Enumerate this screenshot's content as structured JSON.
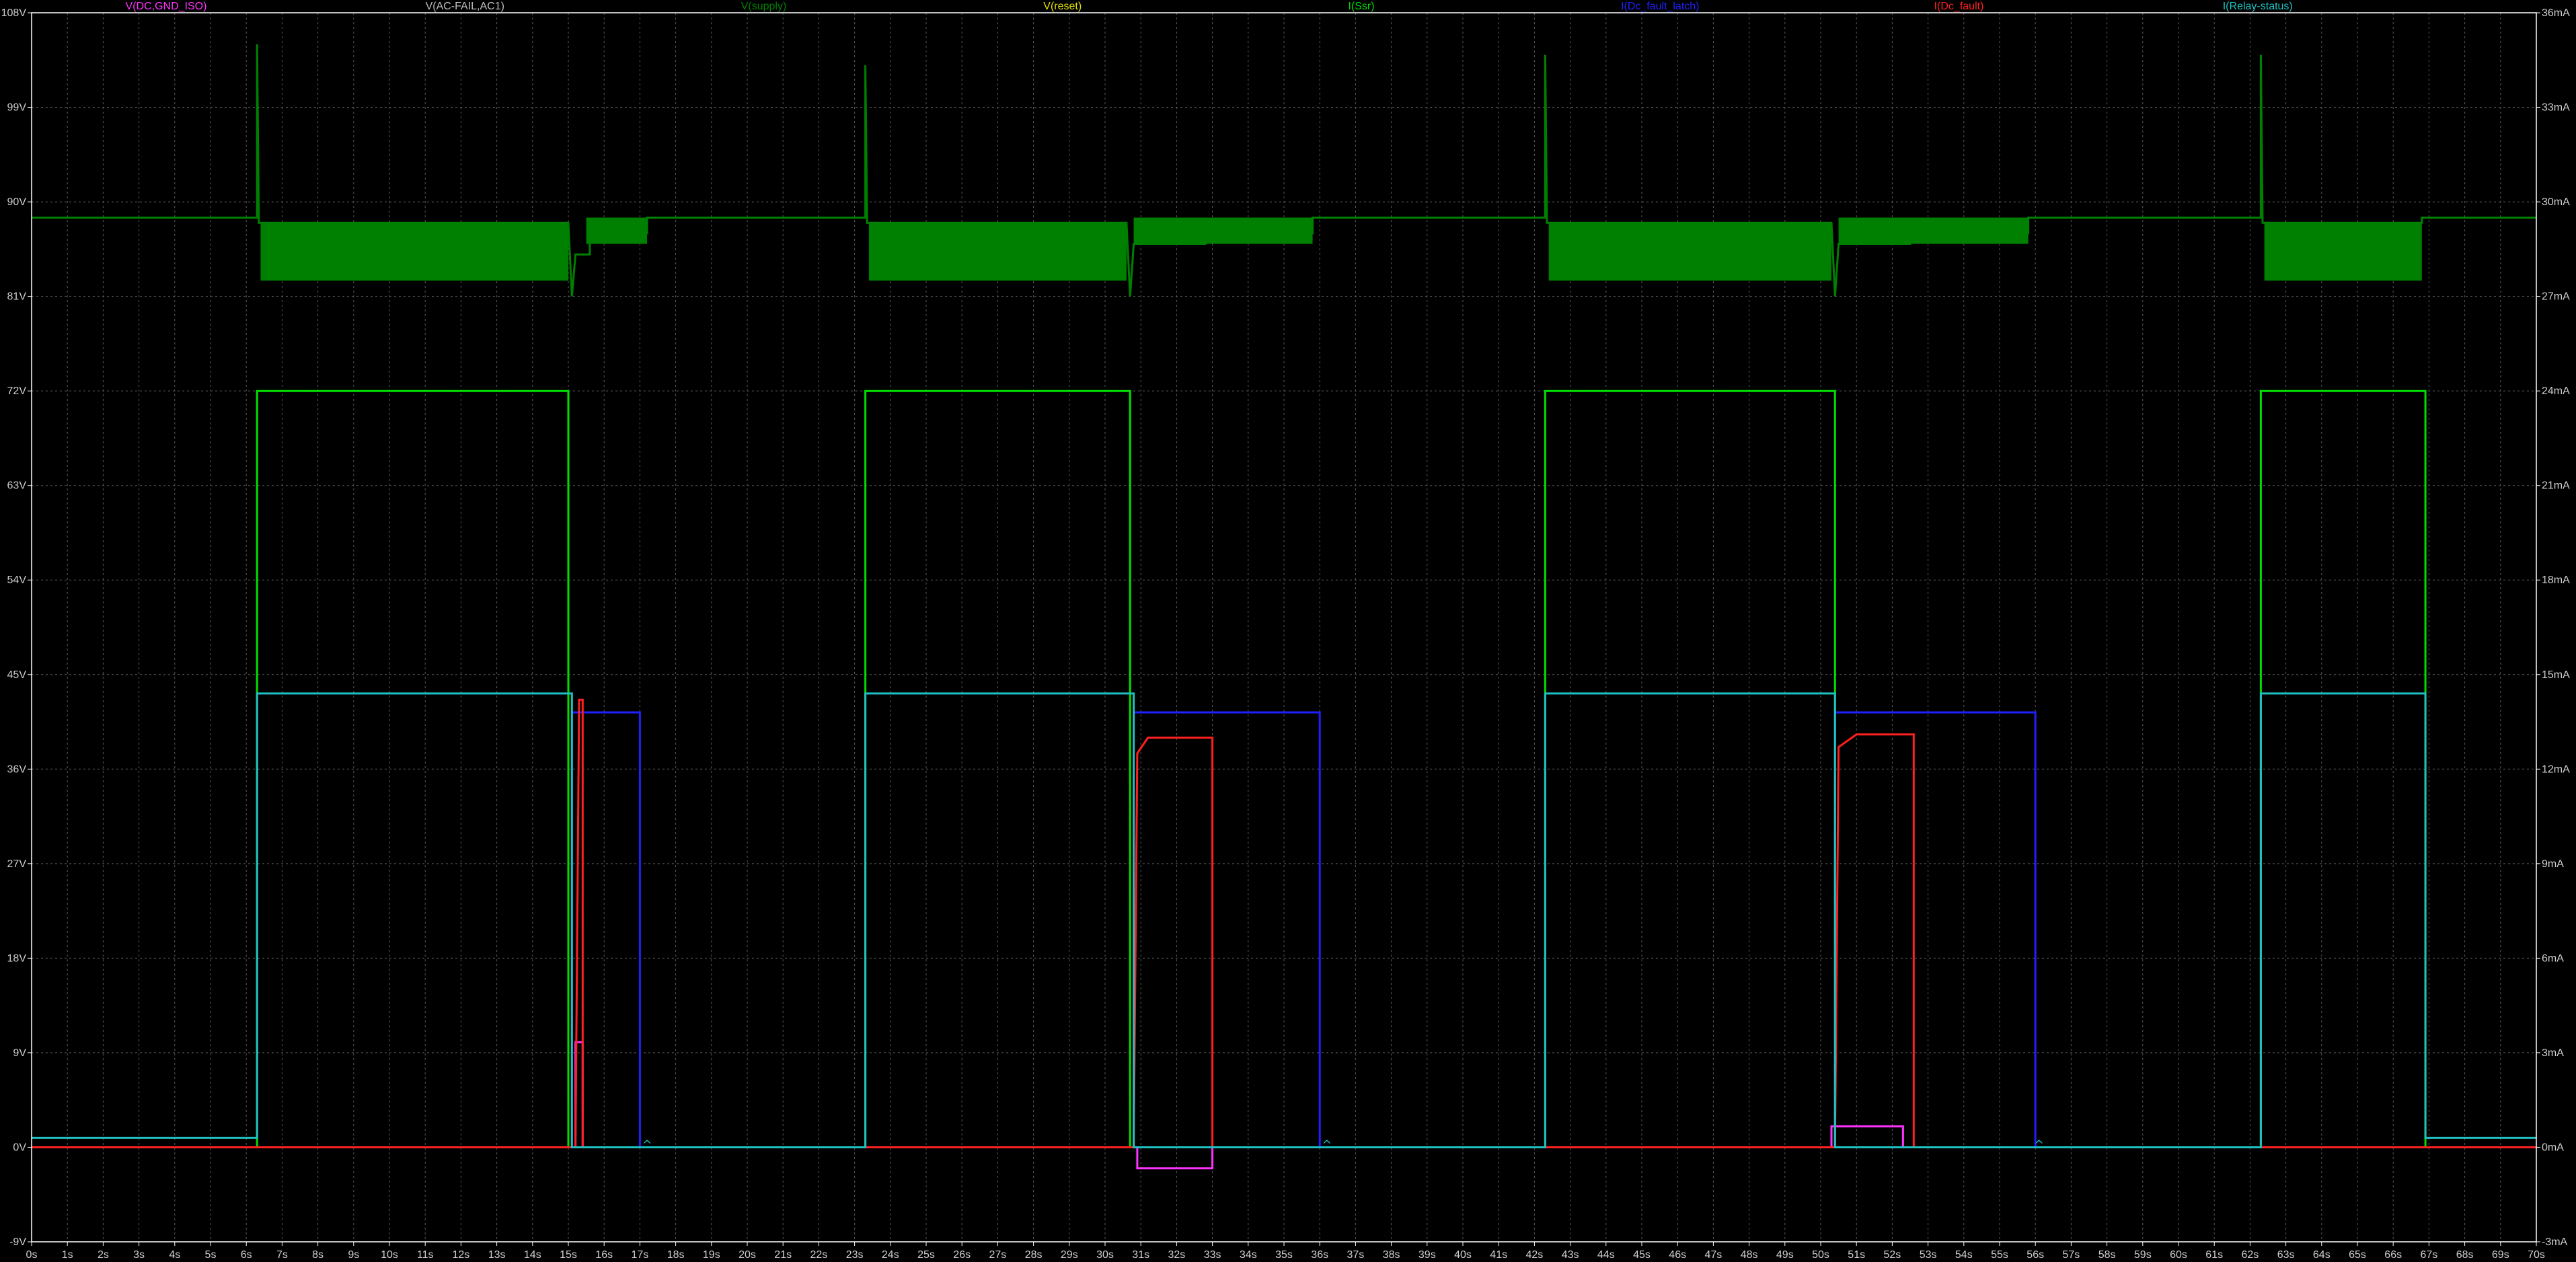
{
  "chart_data": {
    "type": "line",
    "title": "",
    "xlabel": "",
    "ylabel": "",
    "xlim": [
      0,
      70
    ],
    "ylim_left": [
      -9,
      108
    ],
    "ylim_right": [
      -3,
      36
    ],
    "x_unit": "s",
    "left_unit": "V",
    "right_unit": "mA",
    "x_ticks": [
      "0s",
      "1s",
      "2s",
      "3s",
      "4s",
      "5s",
      "6s",
      "7s",
      "8s",
      "9s",
      "10s",
      "11s",
      "12s",
      "13s",
      "14s",
      "15s",
      "16s",
      "17s",
      "18s",
      "19s",
      "20s",
      "21s",
      "22s",
      "23s",
      "24s",
      "25s",
      "26s",
      "27s",
      "28s",
      "29s",
      "30s",
      "31s",
      "32s",
      "33s",
      "34s",
      "35s",
      "36s",
      "37s",
      "38s",
      "39s",
      "40s",
      "41s",
      "42s",
      "43s",
      "44s",
      "45s",
      "46s",
      "47s",
      "48s",
      "49s",
      "50s",
      "51s",
      "52s",
      "53s",
      "54s",
      "55s",
      "56s",
      "57s",
      "58s",
      "59s",
      "60s",
      "61s",
      "62s",
      "63s",
      "64s",
      "65s",
      "66s",
      "67s",
      "68s",
      "69s",
      "70s"
    ],
    "left_ticks": [
      "108V",
      "99V",
      "90V",
      "81V",
      "72V",
      "63V",
      "54V",
      "45V",
      "36V",
      "27V",
      "18V",
      "9V",
      "0V",
      "-9V"
    ],
    "right_ticks": [
      "36mA",
      "33mA",
      "30mA",
      "27mA",
      "24mA",
      "21mA",
      "18mA",
      "15mA",
      "12mA",
      "9mA",
      "6mA",
      "3mA",
      "0mA",
      "-3mA"
    ],
    "grid": true,
    "legend_position": "top",
    "colors": {
      "background": "#000000",
      "grid": "#5a5a5a",
      "axis": "#ffffff"
    },
    "series": [
      {
        "name": "V(DC,GND_ISO)",
        "color": "#ff33ff",
        "axis": "left",
        "points": [
          [
            0,
            0
          ],
          [
            15.2,
            0
          ],
          [
            15.2,
            10
          ],
          [
            15.4,
            10
          ],
          [
            15.4,
            0
          ],
          [
            30.9,
            0
          ],
          [
            30.9,
            -2
          ],
          [
            33.0,
            -2
          ],
          [
            33.0,
            0
          ],
          [
            50.3,
            0
          ],
          [
            50.3,
            2
          ],
          [
            52.3,
            2
          ],
          [
            52.3,
            0
          ],
          [
            70,
            0
          ]
        ]
      },
      {
        "name": "V(AC-FAIL,AC1)",
        "color": "#c0c0c0",
        "axis": "left",
        "points": [
          [
            0,
            0
          ],
          [
            70,
            0
          ]
        ]
      },
      {
        "name": "V(supply)",
        "color": "#008000",
        "axis": "left",
        "points": [
          [
            0,
            88.5
          ],
          [
            6.3,
            88.5
          ],
          [
            6.3,
            105
          ],
          [
            6.35,
            88
          ],
          [
            6.4,
            88
          ],
          [
            15.0,
            88
          ],
          [
            15.1,
            81
          ],
          [
            15.2,
            85
          ],
          [
            15.6,
            85
          ],
          [
            15.6,
            87
          ],
          [
            17.2,
            87
          ],
          [
            17.2,
            88.5
          ],
          [
            23.3,
            88.5
          ],
          [
            23.3,
            103
          ],
          [
            23.35,
            88
          ],
          [
            23.4,
            88
          ],
          [
            30.6,
            88
          ],
          [
            30.7,
            81
          ],
          [
            30.8,
            86
          ],
          [
            32.8,
            86
          ],
          [
            32.8,
            87
          ],
          [
            35.8,
            87
          ],
          [
            35.8,
            88.5
          ],
          [
            42.3,
            88.5
          ],
          [
            42.3,
            104
          ],
          [
            42.35,
            88
          ],
          [
            42.4,
            88
          ],
          [
            50.3,
            88
          ],
          [
            50.4,
            81
          ],
          [
            50.5,
            86
          ],
          [
            52.5,
            86
          ],
          [
            52.5,
            87
          ],
          [
            55.8,
            87
          ],
          [
            55.8,
            88.5
          ],
          [
            62.3,
            88.5
          ],
          [
            62.3,
            104
          ],
          [
            62.35,
            88
          ],
          [
            62.4,
            88
          ],
          [
            66.8,
            88
          ],
          [
            66.8,
            88.5
          ],
          [
            70,
            88.5
          ]
        ],
        "band": [
          [
            6.4,
            15.0,
            82.5,
            88
          ],
          [
            23.4,
            30.6,
            82.5,
            88
          ],
          [
            42.4,
            50.3,
            82.5,
            88
          ],
          [
            62.4,
            66.8,
            82.5,
            88
          ],
          [
            15.5,
            17.2,
            86,
            88.5
          ],
          [
            30.8,
            35.8,
            86,
            88.5
          ],
          [
            50.5,
            55.8,
            86,
            88.5
          ]
        ]
      },
      {
        "name": "V(reset)",
        "color": "#e0e000",
        "axis": "left",
        "points": [
          [
            0,
            0
          ],
          [
            70,
            0
          ]
        ]
      },
      {
        "name": "I(Ssr)",
        "color": "#00dd00",
        "axis": "right",
        "points": [
          [
            0,
            0
          ],
          [
            6.3,
            0
          ],
          [
            6.3,
            24
          ],
          [
            15.0,
            24
          ],
          [
            15.0,
            0
          ],
          [
            23.3,
            0
          ],
          [
            23.3,
            24
          ],
          [
            30.7,
            24
          ],
          [
            30.7,
            0
          ],
          [
            42.3,
            0
          ],
          [
            42.3,
            24
          ],
          [
            50.4,
            24
          ],
          [
            50.4,
            0
          ],
          [
            62.3,
            0
          ],
          [
            62.3,
            24
          ],
          [
            66.9,
            24
          ],
          [
            66.9,
            0
          ],
          [
            70,
            0
          ]
        ]
      },
      {
        "name": "I(Dc_fault_latch)",
        "color": "#2020ff",
        "axis": "right",
        "points": [
          [
            0,
            0
          ],
          [
            15.1,
            0
          ],
          [
            15.1,
            13.8
          ],
          [
            17.0,
            13.8
          ],
          [
            17.0,
            0
          ],
          [
            30.8,
            0
          ],
          [
            30.8,
            13.8
          ],
          [
            36.0,
            13.8
          ],
          [
            36.0,
            0
          ],
          [
            50.4,
            0
          ],
          [
            50.4,
            13.8
          ],
          [
            56.0,
            13.8
          ],
          [
            56.0,
            0
          ],
          [
            70,
            0
          ]
        ]
      },
      {
        "name": "I(Dc_fault)",
        "color": "#ff2020",
        "axis": "right",
        "points": [
          [
            0,
            0
          ],
          [
            15.2,
            0
          ],
          [
            15.3,
            14.2
          ],
          [
            15.4,
            14.2
          ],
          [
            15.4,
            0
          ],
          [
            30.8,
            0
          ],
          [
            30.9,
            12.5
          ],
          [
            31.2,
            13
          ],
          [
            33.0,
            13
          ],
          [
            33.0,
            0
          ],
          [
            50.4,
            0
          ],
          [
            50.5,
            12.7
          ],
          [
            51.0,
            13.1
          ],
          [
            52.6,
            13.1
          ],
          [
            52.6,
            0
          ],
          [
            70,
            0
          ]
        ]
      },
      {
        "name": "I(Relay-status)",
        "color": "#20c0c0",
        "axis": "right",
        "points": [
          [
            0,
            0.3
          ],
          [
            6.3,
            0.3
          ],
          [
            6.3,
            14.4
          ],
          [
            15.1,
            14.4
          ],
          [
            15.1,
            0
          ],
          [
            23.3,
            0
          ],
          [
            23.3,
            14.4
          ],
          [
            30.8,
            14.4
          ],
          [
            30.8,
            0
          ],
          [
            42.3,
            0
          ],
          [
            42.3,
            14.4
          ],
          [
            50.4,
            14.4
          ],
          [
            50.4,
            0
          ],
          [
            62.3,
            0
          ],
          [
            62.3,
            14.4
          ],
          [
            66.9,
            14.4
          ],
          [
            66.9,
            0.3
          ],
          [
            70,
            0.3
          ]
        ]
      }
    ],
    "annotations": [
      {
        "text": "^",
        "x": 17.2
      },
      {
        "text": "^",
        "x": 36.2
      },
      {
        "text": "^",
        "x": 56.1
      }
    ]
  }
}
